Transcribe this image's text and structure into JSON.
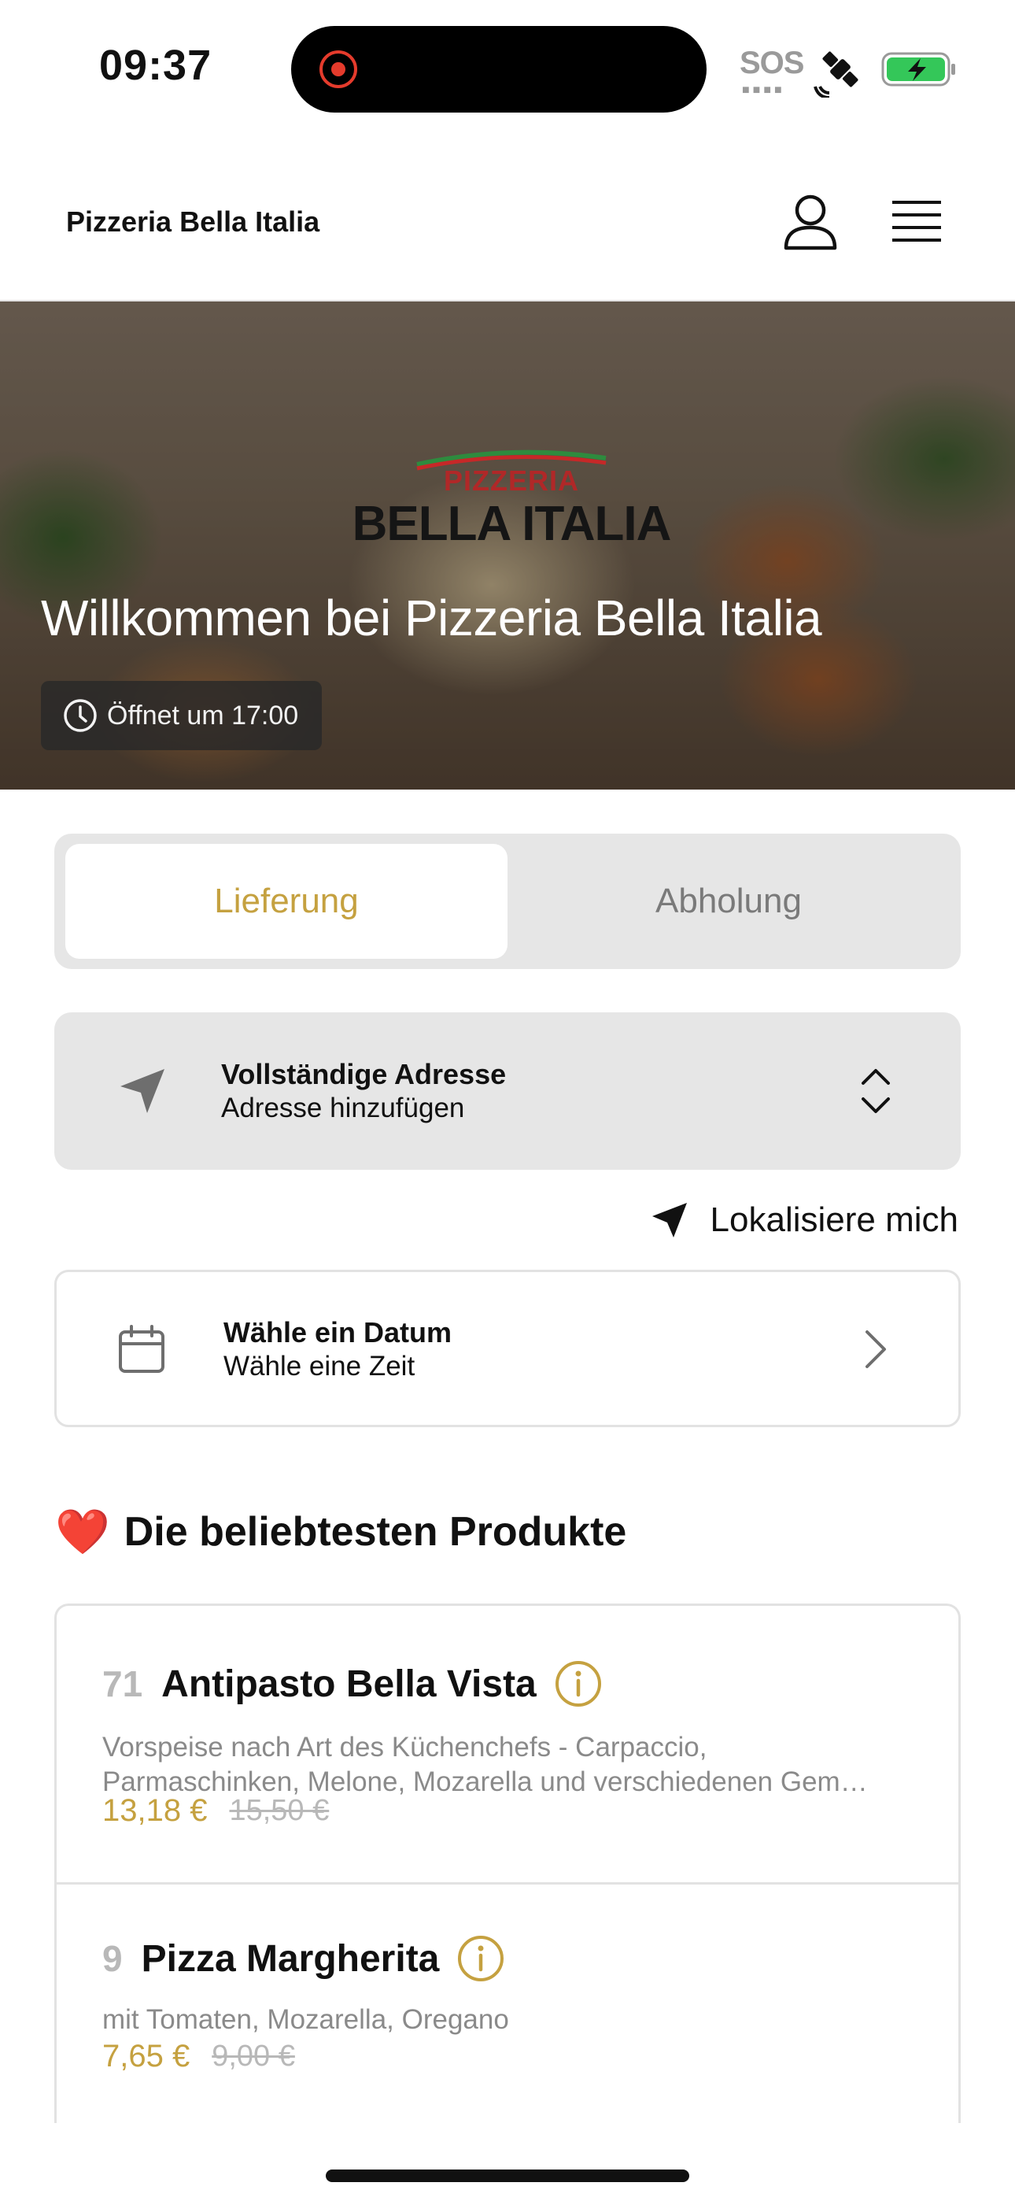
{
  "status_bar": {
    "time": "09:37",
    "sos": "SOS",
    "battery_color": "#34c759"
  },
  "header": {
    "brand": "Pizzeria Bella Italia",
    "user_icon": "user-icon",
    "menu_icon": "hamburger-menu-icon"
  },
  "hero": {
    "logo_small": "PIZZERIA",
    "logo_big": "BELLA ITALIA",
    "title": "Willkommen bei Pizzeria Bella Italia",
    "opening": "Öffnet um 17:00"
  },
  "order_mode": {
    "options": [
      "Lieferung",
      "Abholung"
    ],
    "selected": "Lieferung",
    "accent_color": "#c5a140"
  },
  "address": {
    "title": "Vollständige Adresse",
    "subtitle": "Adresse hinzufügen"
  },
  "locate": {
    "label": "Lokalisiere mich"
  },
  "date_picker": {
    "title": "Wähle ein Datum",
    "subtitle": "Wähle eine Zeit"
  },
  "popular": {
    "emoji": "❤️",
    "heading": "Die beliebtesten Produkte",
    "items": [
      {
        "number": "71",
        "name": "Antipasto Bella Vista",
        "description_line1": "Vorspeise nach Art des Küchenchefs - Carpaccio,",
        "description_line2": "Parmaschinken, Melone, Mozarella und verschiedenen Gem…",
        "price": "13,18 €",
        "old_price": "15,50 €"
      },
      {
        "number": "9",
        "name": "Pizza Margherita",
        "description_line1": "mit Tomaten, Mozarella, Oregano",
        "price": "7,65 €",
        "old_price": "9,00 €"
      }
    ]
  }
}
